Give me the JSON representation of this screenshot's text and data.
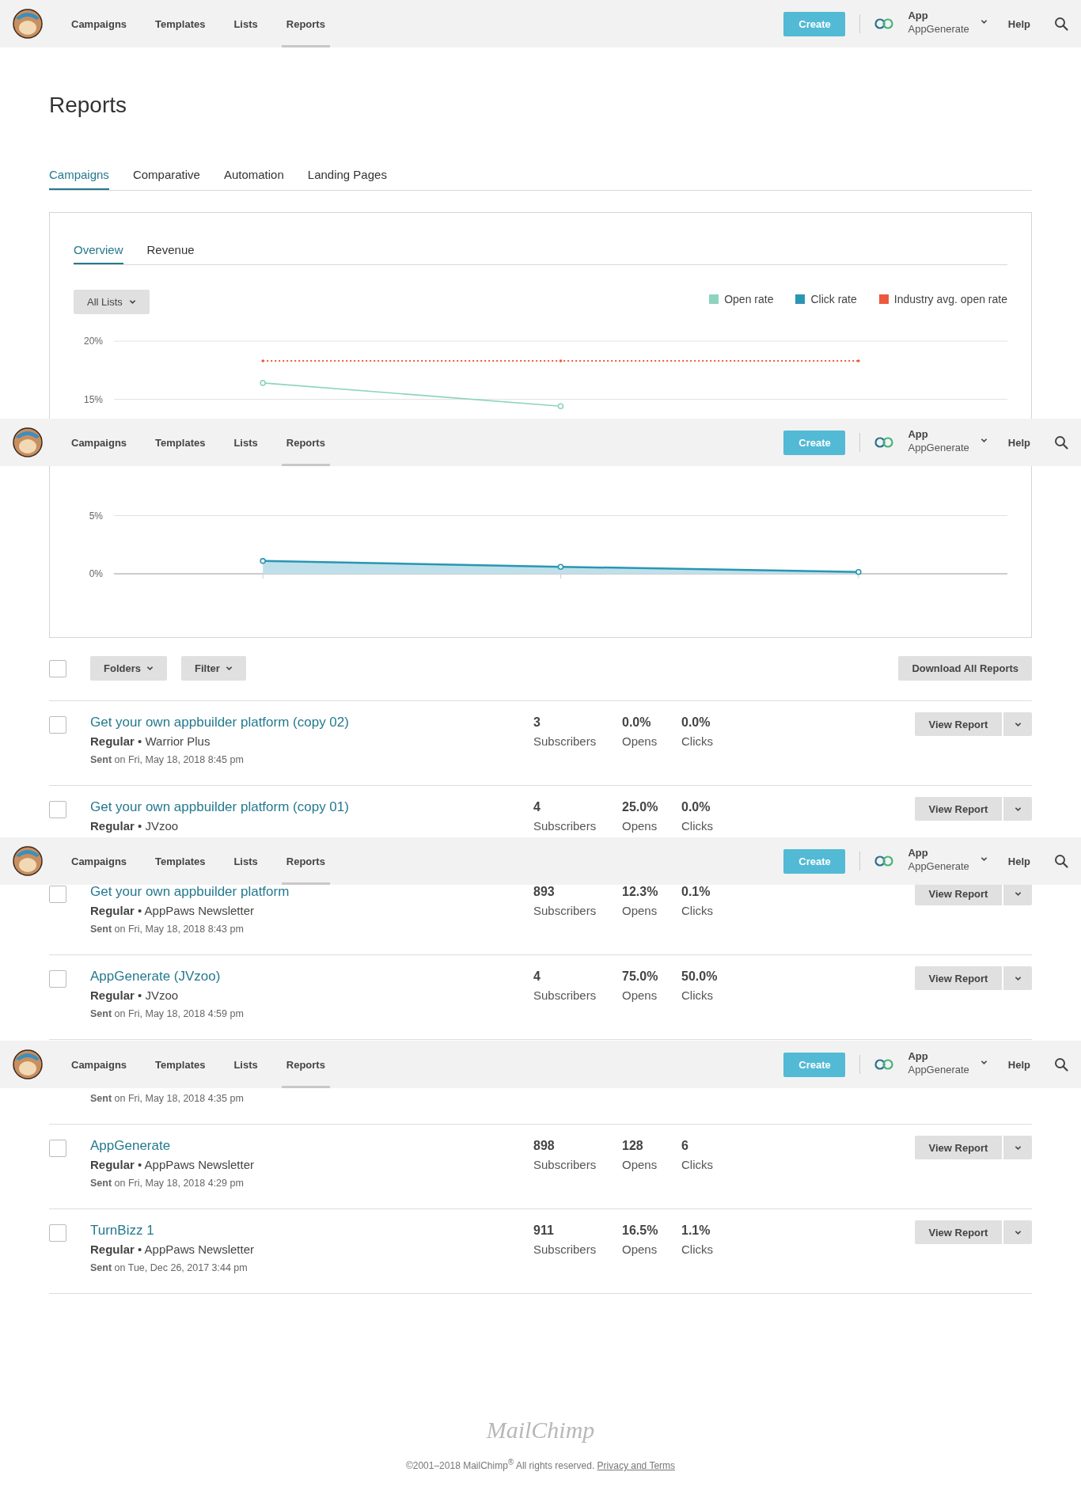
{
  "headers": [
    {
      "nav": [
        {
          "label": "Campaigns",
          "selected": false
        },
        {
          "label": "Templates",
          "selected": false
        },
        {
          "label": "Lists",
          "selected": false
        },
        {
          "label": "Reports",
          "selected": true
        }
      ],
      "create": "Create",
      "account": {
        "name": "App",
        "org": "AppGenerate"
      },
      "help": "Help"
    },
    {
      "nav": [
        {
          "label": "Campaigns",
          "selected": false
        },
        {
          "label": "Templates",
          "selected": false
        },
        {
          "label": "Lists",
          "selected": false
        },
        {
          "label": "Reports",
          "selected": true
        }
      ],
      "create": "Create",
      "account": {
        "name": "App",
        "org": "AppGenerate"
      },
      "help": "Help"
    },
    {
      "nav": [
        {
          "label": "Campaigns",
          "selected": false
        },
        {
          "label": "Templates",
          "selected": false
        },
        {
          "label": "Lists",
          "selected": false
        },
        {
          "label": "Reports",
          "selected": true
        }
      ],
      "create": "Create",
      "account": {
        "name": "App",
        "org": "AppGenerate"
      },
      "help": "Help"
    },
    {
      "nav": [
        {
          "label": "Campaigns",
          "selected": false
        },
        {
          "label": "Templates",
          "selected": false
        },
        {
          "label": "Lists",
          "selected": false
        },
        {
          "label": "Reports",
          "selected": true
        }
      ],
      "create": "Create",
      "account": {
        "name": "App",
        "org": "AppGenerate"
      },
      "help": "Help"
    }
  ],
  "page_title": "Reports",
  "tabs": [
    {
      "label": "Campaigns",
      "selected": true
    },
    {
      "label": "Comparative",
      "selected": false
    },
    {
      "label": "Automation",
      "selected": false
    },
    {
      "label": "Landing Pages",
      "selected": false
    }
  ],
  "chart_card": {
    "tabs": [
      {
        "label": "Overview",
        "selected": true
      },
      {
        "label": "Revenue",
        "selected": false
      }
    ],
    "list_filter": "All Lists",
    "chart_data": {
      "type": "line",
      "ylim": [
        0,
        20
      ],
      "yticks": [
        {
          "value": 0,
          "label": "0%"
        },
        {
          "value": 5,
          "label": "5%"
        },
        {
          "value": 15,
          "label": "15%"
        },
        {
          "value": 20,
          "label": "20%"
        }
      ],
      "series": [
        {
          "name": "Open rate",
          "color": "#8ed3be",
          "marker": true,
          "values": [
            16.4,
            14.4,
            null
          ]
        },
        {
          "name": "Click rate",
          "color": "#2a96b3",
          "marker": true,
          "values": [
            1.1,
            0.6,
            0.15
          ]
        },
        {
          "name": "Industry avg. open rate",
          "color": "#eb5a3c",
          "marker": true,
          "line_style": "dotted",
          "values": [
            18.3,
            18.3,
            18.3
          ]
        }
      ]
    }
  },
  "toolbar": {
    "select_all_checked": false,
    "folders": "Folders",
    "filter": "Filter",
    "download": "Download All Reports"
  },
  "campaigns": [
    {
      "checked": false,
      "title": "Get your own appbuilder platform (copy 02)",
      "meta": "**Regular** • Warrior Plus",
      "sent": "**Sent** on Fri, May 18, 2018 8:45 pm",
      "subscribers": "3",
      "subscribers_label": "Subscribers",
      "opens": "0.0%",
      "opens_label": "Opens",
      "clicks": "0.0%",
      "clicks_label": "Clicks",
      "view": "View Report"
    },
    {
      "checked": false,
      "title": "Get your own appbuilder platform (copy 01)",
      "meta": "**Regular** • JVzoo",
      "subscribers": "4",
      "subscribers_label": "Subscribers",
      "opens": "25.0%",
      "opens_label": "Opens",
      "clicks": "0.0%",
      "clicks_label": "Clicks",
      "view": "View Report"
    },
    {
      "checked": false,
      "title": "Get your own appbuilder platform",
      "meta": "**Regular** • AppPaws Newsletter",
      "sent": "**Sent** on Fri, May 18, 2018 8:43 pm",
      "subscribers": "893",
      "subscribers_label": "Subscribers",
      "opens": "12.3%",
      "opens_label": "Opens",
      "clicks": "0.1%",
      "clicks_label": "Clicks",
      "view": "View Report"
    },
    {
      "checked": false,
      "title": "AppGenerate (JVzoo)",
      "meta": "**Regular** • JVzoo",
      "sent": "**Sent** on Fri, May 18, 2018 4:59 pm",
      "subscribers": "4",
      "subscribers_label": "Subscribers",
      "opens": "75.0%",
      "opens_label": "Opens",
      "clicks": "50.0%",
      "clicks_label": "Clicks",
      "view": "View Report"
    },
    {
      "sent": "**Sent** on Fri, May 18, 2018 4:35 pm"
    },
    {
      "checked": false,
      "title": "AppGenerate",
      "meta": "**Regular** • AppPaws Newsletter",
      "sent": "**Sent** on Fri, May 18, 2018 4:29 pm",
      "subscribers": "898",
      "subscribers_label": "Subscribers",
      "opens": "128",
      "opens_label": "Opens",
      "clicks": "6",
      "clicks_label": "Clicks",
      "view": "View Report"
    },
    {
      "checked": false,
      "title": "TurnBizz 1",
      "meta": "**Regular** • AppPaws Newsletter",
      "sent": "**Sent** on Tue, Dec 26, 2017 3:44 pm",
      "subscribers": "911",
      "subscribers_label": "Subscribers",
      "opens": "16.5%",
      "opens_label": "Opens",
      "clicks": "1.1%",
      "clicks_label": "Clicks",
      "view": "View Report"
    }
  ],
  "footer": {
    "logo": "MailChimp",
    "copyright": "©2001–2018 MailChimp$^{®}$ All rights reserved.",
    "link": "Privacy and Terms"
  }
}
